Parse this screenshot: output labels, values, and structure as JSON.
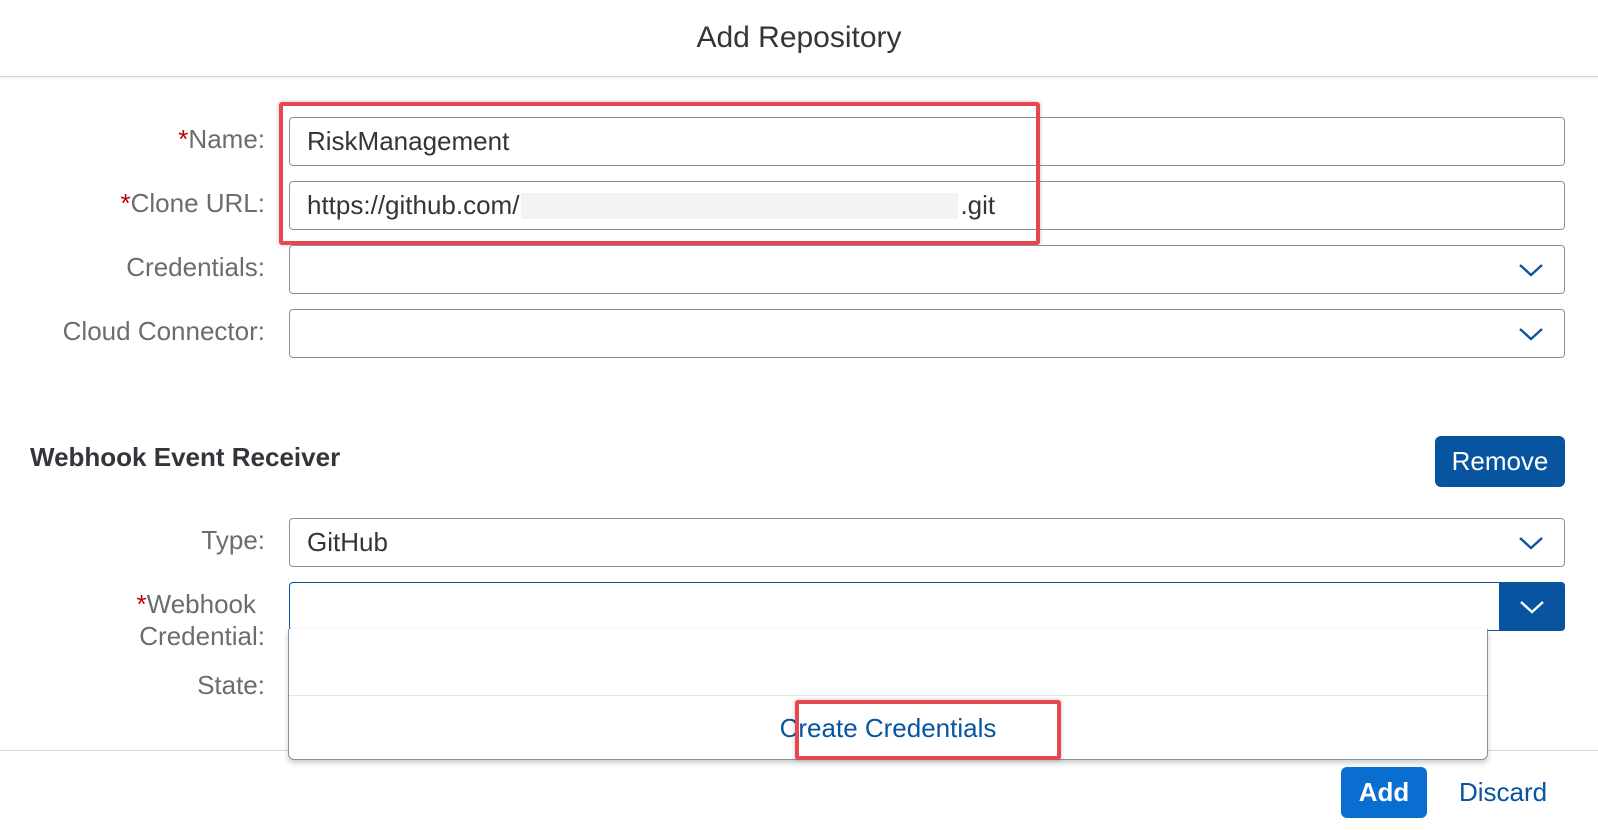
{
  "dialog": {
    "title": "Add Repository"
  },
  "form": {
    "name": {
      "required_mark": "*",
      "label": "Name:",
      "value": "RiskManagement"
    },
    "clone_url": {
      "required_mark": "*",
      "label": "Clone URL:",
      "value_prefix": "https://github.com/",
      "value_suffix": ".git"
    },
    "credentials": {
      "label": "Credentials:",
      "value": ""
    },
    "cloud_connector": {
      "label": "Cloud Connector:",
      "value": ""
    }
  },
  "webhook": {
    "title": "Webhook Event Receiver",
    "remove_label": "Remove",
    "type": {
      "label": "Type:",
      "value": "GitHub"
    },
    "credential": {
      "required_mark": "*",
      "label_line1": "Webhook",
      "label_line2": "Credential:",
      "value": ""
    },
    "state": {
      "label": "State:"
    },
    "dropdown": {
      "empty_item": "",
      "create_label": "Create Credentials"
    }
  },
  "footer": {
    "add_label": "Add",
    "discard_label": "Discard"
  },
  "colors": {
    "accent": "#0a6ed1",
    "dark_accent": "#0854a0",
    "required": "#bb0000",
    "highlight": "#e8474f"
  },
  "icons": {
    "dropdown": "chevron-down-icon"
  }
}
